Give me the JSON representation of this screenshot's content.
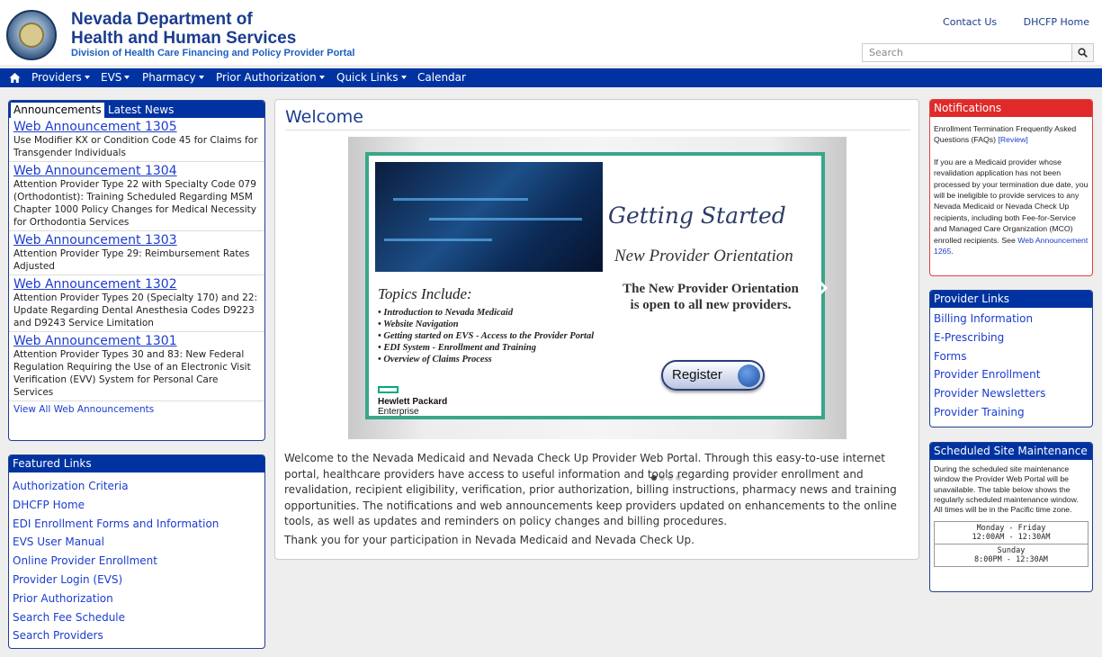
{
  "header": {
    "title_line1": "Nevada Department of",
    "title_line2": "Health and Human Services",
    "subtitle": "Division of Health Care Financing and Policy Provider Portal",
    "links": [
      "Contact Us",
      "DHCFP Home"
    ],
    "search_placeholder": "Search"
  },
  "nav": {
    "items": [
      {
        "label": "Providers"
      },
      {
        "label": "EVS"
      },
      {
        "label": "Pharmacy"
      },
      {
        "label": "Prior Authorization"
      },
      {
        "label": "Quick Links"
      },
      {
        "label": "Calendar"
      }
    ]
  },
  "announcements": {
    "tabs": [
      "Announcements",
      "Latest News"
    ],
    "items": [
      {
        "title": "Web Announcement 1305",
        "desc": "Use Modifier KX or Condition Code 45 for Claims for Transgender Individuals"
      },
      {
        "title": "Web Announcement 1304",
        "desc": "Attention Provider Type 22 with Specialty Code 079 (Orthodontist): Training Scheduled Regarding MSM Chapter 1000 Policy Changes for Medical Necessity for Orthodontia Services"
      },
      {
        "title": "Web Announcement 1303",
        "desc": "Attention Provider Type 29: Reimbursement Rates Adjusted"
      },
      {
        "title": "Web Announcement 1302",
        "desc": "Attention Provider Types 20 (Specialty 170) and 22: Update Regarding Dental Anesthesia Codes D9223 and D9243 Service Limitation"
      },
      {
        "title": "Web Announcement 1301",
        "desc": "Attention Provider Types 30 and 83: New Federal Regulation Requiring the Use of an Electronic Visit Verification (EVV) System for Personal Care Services"
      }
    ],
    "view_all": "View All Web Announcements"
  },
  "featured": {
    "title": "Featured Links",
    "links": [
      "Authorization Criteria",
      "DHCFP Home",
      "EDI Enrollment Forms and Information",
      "EVS User Manual",
      "Online Provider Enrollment",
      "Provider Login (EVS)",
      "Prior Authorization",
      "Search Fee Schedule",
      "Search Providers"
    ]
  },
  "main": {
    "heading": "Welcome",
    "slide": {
      "getting_started": "Getting Started",
      "npo": "New Provider Orientation",
      "open_line1": "The New Provider Orientation",
      "open_line2": "is open to all new providers.",
      "topics_heading": "Topics Include:",
      "topics": [
        "Introduction to Nevada Medicaid",
        "Website Navigation",
        "Getting started on EVS - Access to the Provider Portal",
        "EDI System - Enrollment and Training",
        "Overview of Claims Process"
      ],
      "register": "Register",
      "hpe_line1": "Hewlett Packard",
      "hpe_line2": "Enterprise",
      "active_dot": 1,
      "dot_count": 4
    },
    "intro": "Welcome to the Nevada Medicaid and Nevada Check Up Provider Web Portal. Through this easy-to-use internet portal, healthcare providers have access to useful information and tools regarding provider enrollment and revalidation, recipient eligibility, verification, prior authorization, billing instructions, pharmacy news and training opportunities. The notifications and web announcements keep providers updated on enhancements to the online tools, as well as updates and reminders on policy changes and billing procedures.",
    "thanks": "Thank you for your participation in Nevada Medicaid and Nevada Check Up."
  },
  "notifications": {
    "title": "Notifications",
    "p1": "Enrollment Termination Frequently Asked Questions (FAQs)",
    "p1_link": "[Review]",
    "p2": "If you are a Medicaid provider whose revalidation application has not been processed by your termination due date, you will be ineligible to provide services to any Nevada Medicaid or Nevada Check Up recipients, including both Fee-for-Service and Managed Care Organization (MCO) enrolled recipients. See",
    "p2_link": "Web Announcement 1265",
    "p2_end": "."
  },
  "provider_links": {
    "title": "Provider Links",
    "links": [
      "Billing Information",
      "E-Prescribing",
      "Forms",
      "Provider Enrollment",
      "Provider Newsletters",
      "Provider Training"
    ]
  },
  "maintenance": {
    "title": "Scheduled Site Maintenance",
    "text": "During the scheduled site maintenance window the Provider Web Portal will be unavailable. The table below shows the regularly scheduled maintenance window. All times will be in the Pacific time zone.",
    "rows": [
      {
        "day": "Monday - Friday",
        "time": "12:00AM - 12:30AM"
      },
      {
        "day": "Sunday",
        "time": "8:00PM - 12:30AM"
      }
    ]
  },
  "colors": {
    "brand_blue": "#0033a1",
    "alert_red": "#e02a2a",
    "link_blue": "#1b3cd0"
  }
}
